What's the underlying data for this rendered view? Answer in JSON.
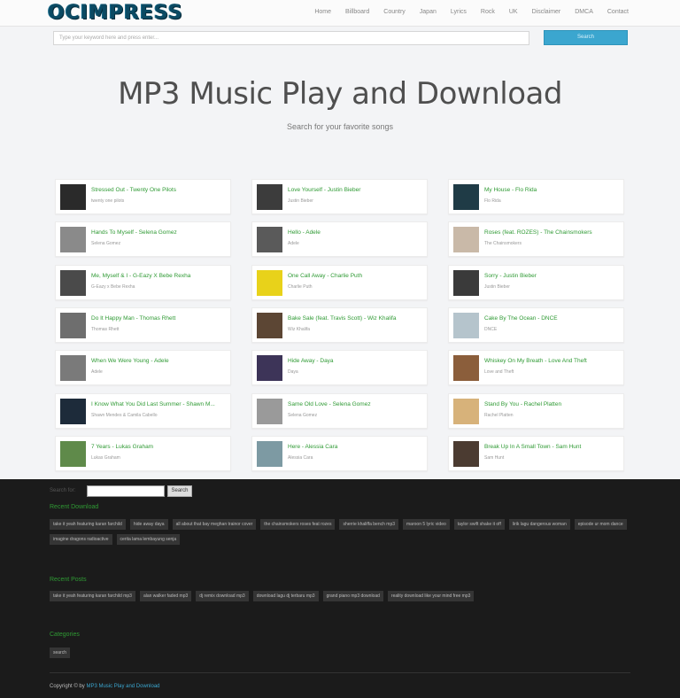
{
  "header": {
    "logo": "OCIMPRESS",
    "nav": [
      "Home",
      "Billboard",
      "Country",
      "Japan",
      "Lyrics",
      "Rock",
      "UK",
      "Disclaimer",
      "DMCA",
      "Contact"
    ],
    "search_placeholder": "Type your keyword here and press enter...",
    "search_button": "Search"
  },
  "hero": {
    "title": "MP3 Music Play and Download",
    "subtitle": "Search for your favorite songs"
  },
  "songs": [
    {
      "title": "Stressed Out - Twenty One Pilots",
      "artist": "twenty one pilots",
      "thumb": "#2a2a2a"
    },
    {
      "title": "Love Yourself - Justin Bieber",
      "artist": "Justin Bieber",
      "thumb": "#3c3c3c"
    },
    {
      "title": "My House - Flo Rida",
      "artist": "Flo Rida",
      "thumb": "#1f3b46"
    },
    {
      "title": "Hands To Myself - Selena Gomez",
      "artist": "Selena Gomez",
      "thumb": "#8a8a8a"
    },
    {
      "title": "Hello - Adele",
      "artist": "Adele",
      "thumb": "#5a5a5a"
    },
    {
      "title": "Roses (feat. ROZES) - The Chainsmokers",
      "artist": "The Chainsmokers",
      "thumb": "#c9b9a8"
    },
    {
      "title": "Me, Myself & I - G-Eazy X Bebe Rexha",
      "artist": "G-Eazy x Bebe Rexha",
      "thumb": "#4a4a4a"
    },
    {
      "title": "One Call Away - Charlie Puth",
      "artist": "Charlie Puth",
      "thumb": "#e8d21a"
    },
    {
      "title": "Sorry - Justin Bieber",
      "artist": "Justin Bieber",
      "thumb": "#3a3a3a"
    },
    {
      "title": "Do It Happy Man - Thomas Rhett",
      "artist": "Thomas Rhett",
      "thumb": "#6e6e6e"
    },
    {
      "title": "Bake Sale (feat. Travis Scott) - Wiz Khalifa",
      "artist": "Wiz Khalifa",
      "thumb": "#5c4634"
    },
    {
      "title": "Cake By The Ocean - DNCE",
      "artist": "DNCE",
      "thumb": "#b5c4cc"
    },
    {
      "title": "When We Were Young - Adele",
      "artist": "Adele",
      "thumb": "#7a7a7a"
    },
    {
      "title": "Hide Away - Daya",
      "artist": "Daya",
      "thumb": "#3d3458"
    },
    {
      "title": "Whiskey On My Breath - Love And Theft",
      "artist": "Love and Theft",
      "thumb": "#8b5e3b"
    },
    {
      "title": "I Know What You Did Last Summer - Shawn M...",
      "artist": "Shawn Mendes & Camila Cabello",
      "thumb": "#1d2b3a"
    },
    {
      "title": "Same Old Love - Selena Gomez",
      "artist": "Selena Gomez",
      "thumb": "#9a9a9a"
    },
    {
      "title": "Stand By You - Rachel Platten",
      "artist": "Rachel Platten",
      "thumb": "#d7b27a"
    },
    {
      "title": "7 Years - Lukas Graham",
      "artist": "Lukas Graham",
      "thumb": "#5f8a4a"
    },
    {
      "title": "Here - Alessia Cara",
      "artist": "Alessia Cara",
      "thumb": "#7d9aa3"
    },
    {
      "title": "Break Up In A Small Town - Sam Hunt",
      "artist": "Sam Hunt",
      "thumb": "#4b3b31"
    }
  ],
  "footer": {
    "search_label": "Search for:",
    "search_button": "Search",
    "recent_download_heading": "Recent Download",
    "recent_downloads": [
      "take it yeah featuring karan farchild",
      "hide away daya",
      "all about that bay meghan trainor cover",
      "the chainsmokers roses feat rozes",
      "sherrie khaliffa bench mp3",
      "maroon 5 lyric video",
      "taylor swift shake it off",
      "lirik lagu dangerous woman",
      "episode ur mom dance",
      "imagine dragons radioactive",
      "cerita lama lembayung senja"
    ],
    "recent_posts_heading": "Recent Posts",
    "recent_posts": [
      "take it yeah featuring karan farchild mp3",
      "alan walker faded mp3",
      "dj remix download mp3",
      "download lagu dj terbaru mp3",
      "grand piano mp3 download",
      "reality download like your mind free mp3"
    ],
    "categories_heading": "Categories",
    "categories": [
      "search"
    ],
    "copyright_prefix": "Copyright © by",
    "copyright_link": "MP3 Music Play and Download"
  },
  "colors": {
    "accent": "#3ba6cf",
    "link_green": "#2f9a34",
    "footer_bg": "#1b1b1b"
  }
}
